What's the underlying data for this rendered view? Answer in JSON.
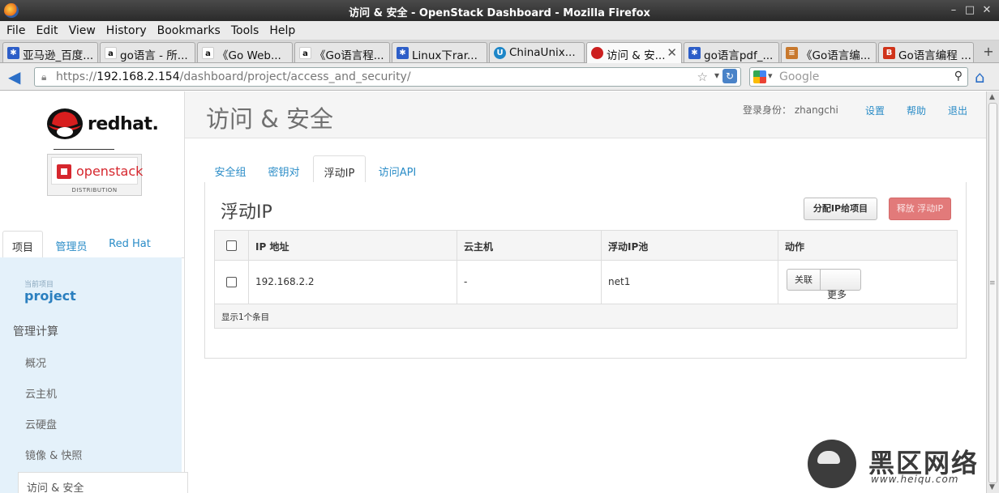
{
  "window": {
    "title": "访问 & 安全 - OpenStack Dashboard - Mozilla Firefox",
    "minimize": "–",
    "maximize": "□",
    "close": "✕"
  },
  "menu": [
    "File",
    "Edit",
    "View",
    "History",
    "Bookmarks",
    "Tools",
    "Help"
  ],
  "tabs": [
    {
      "label": "亚马逊_百度...",
      "icon": "paw-icon",
      "color": "#2d5ec8"
    },
    {
      "label": "go语言 - 所...",
      "icon": "amazon-icon",
      "color": "#f0a020"
    },
    {
      "label": "《Go Web...",
      "icon": "amazon-icon",
      "color": "#f0a020"
    },
    {
      "label": "《Go语言程...",
      "icon": "amazon-icon",
      "color": "#f0a020"
    },
    {
      "label": "Linux下rar...",
      "icon": "paw-icon",
      "color": "#2d5ec8"
    },
    {
      "label": "ChinaUnix...",
      "icon": "chinaunix-icon",
      "color": "#1d86c8"
    },
    {
      "label": "访问 & 安...",
      "icon": "redhat-icon",
      "color": "#cc1f1f",
      "active": true
    },
    {
      "label": "go语言pdf_...",
      "icon": "paw-icon",
      "color": "#2d5ec8"
    },
    {
      "label": "《Go语言编...",
      "icon": "book-icon",
      "color": "#c8782d"
    },
    {
      "label": "Go语言编程 ...",
      "icon": "b-logo-icon",
      "color": "#d0331a"
    }
  ],
  "nav": {
    "url_prefix": "https://",
    "url_host": "192.168.2.154",
    "url_path": "/dashboard/project/access_and_security/",
    "search_placeholder": "Google"
  },
  "sidebar": {
    "brand": "redhat.",
    "product": "openstack",
    "product_sub": "DISTRIBUTION",
    "tabs": [
      "项目",
      "管理员",
      "Red Hat"
    ],
    "current_label": "当前项目",
    "current_project": "project",
    "section": "管理计算",
    "items": [
      "概况",
      "云主机",
      "云硬盘",
      "镜像 & 快照",
      "访问 & 安全"
    ]
  },
  "header": {
    "title": "访问 & 安全",
    "user_label": "登录身份： zhangchi",
    "links": [
      "设置",
      "帮助",
      "退出"
    ]
  },
  "content": {
    "tabs": [
      "安全组",
      "密钥对",
      "浮动IP",
      "访问API"
    ],
    "active_tab": 2,
    "table_title": "浮动IP",
    "allocate_button": "分配IP给项目",
    "release_button": "释放 浮动IP",
    "columns": [
      "IP 地址",
      "云主机",
      "浮动IP池",
      "动作"
    ],
    "rows": [
      {
        "ip": "192.168.2.2",
        "instance": "-",
        "pool": "net1",
        "action": "关联",
        "more": "更多"
      }
    ],
    "footer": "显示1个条目"
  },
  "watermark": {
    "text": "黑区网络",
    "url": "www.heiqu.com"
  }
}
